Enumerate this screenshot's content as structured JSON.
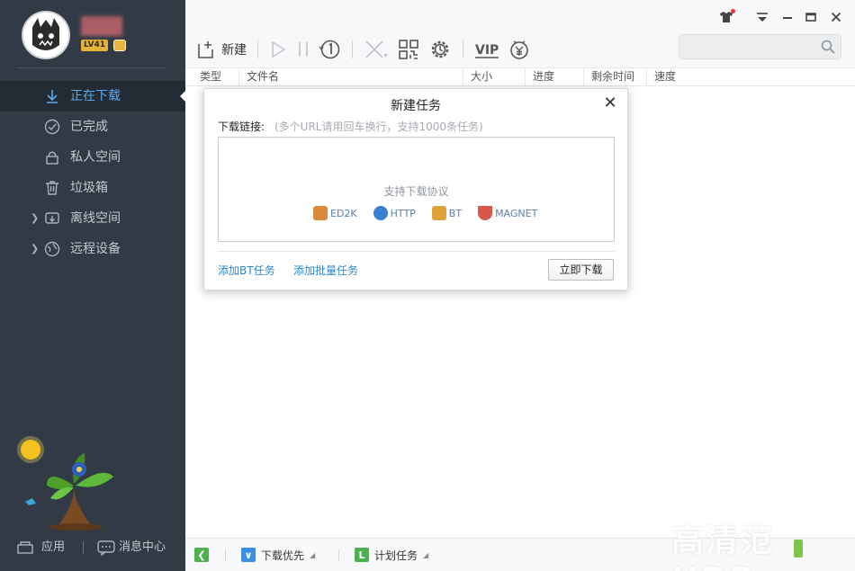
{
  "user": {
    "level": "LV41"
  },
  "nav": {
    "items": [
      {
        "label": "正在下载"
      },
      {
        "label": "已完成"
      },
      {
        "label": "私人空间"
      },
      {
        "label": "垃圾箱"
      },
      {
        "label": "离线空间"
      },
      {
        "label": "远程设备"
      }
    ]
  },
  "sidebar_bottom": {
    "apps_label": "应用",
    "messages_label": "消息中心"
  },
  "toolbar": {
    "new_label": "新建"
  },
  "search": {
    "placeholder": ""
  },
  "columns": [
    "类型",
    "文件名",
    "大小",
    "进度",
    "剩余时间",
    "速度"
  ],
  "dialog": {
    "title": "新建任务",
    "link_label": "下载链接:",
    "link_hint": "(多个URL请用回车换行，支持1000条任务)",
    "protocols_title": "支持下载协议",
    "protocols": [
      "ED2K",
      "HTTP",
      "BT",
      "MAGNET"
    ],
    "add_bt_label": "添加BT任务",
    "add_batch_label": "添加批量任务",
    "download_now_label": "立即下载"
  },
  "statusbar": {
    "priority_label": "下载优先",
    "schedule_label": "计划任务"
  },
  "colors": {
    "sidebar": "#313a45",
    "active_nav": "#5aa9f0",
    "link": "#2b87d6",
    "vip": "#2b87d6"
  }
}
